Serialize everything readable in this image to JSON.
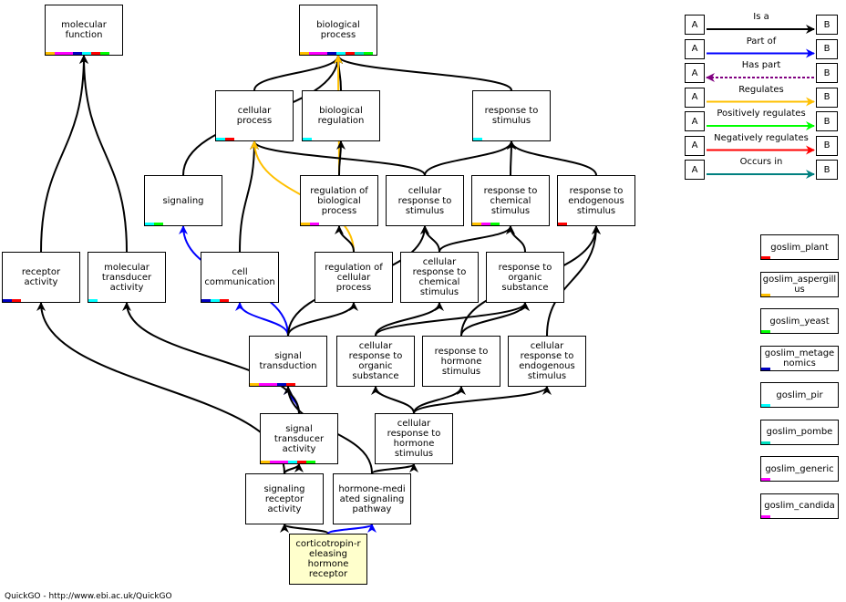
{
  "colors": {
    "is_a": "#000000",
    "part_of": "#0000ff",
    "has_part": "#800080",
    "regulates": "#ffc000",
    "positively_regulates": "#00ff00",
    "negatively_regulates": "#ff0000",
    "occurs_in": "#008080",
    "query_fill": "#ffffcc",
    "slim_orange": "#ffc000",
    "slim_magenta": "#ff00ff",
    "slim_blue": "#0000c0",
    "slim_cyan": "#00ffff",
    "slim_red": "#ff0000",
    "slim_teal": "#00e0c0",
    "slim_green": "#00ff00",
    "slim_darkred": "#e00000"
  },
  "nodes": [
    {
      "id": "mf",
      "label": "molecular\nfunction",
      "slims": [
        "orange",
        "magenta",
        "magenta",
        "blue",
        "cyan",
        "red",
        "green"
      ]
    },
    {
      "id": "bp",
      "label": "biological\nprocess",
      "slims": [
        "orange",
        "magenta",
        "magenta",
        "blue",
        "cyan",
        "red",
        "teal",
        "green"
      ]
    },
    {
      "id": "cp",
      "label": "cellular\nprocess",
      "slims": [
        "cyan",
        "red"
      ]
    },
    {
      "id": "br",
      "label": "biological\nregulation",
      "slims": [
        "cyan"
      ]
    },
    {
      "id": "rts",
      "label": "response to\nstimulus",
      "slims": [
        "cyan"
      ]
    },
    {
      "id": "sig",
      "label": "signaling",
      "slims": [
        "cyan",
        "green"
      ]
    },
    {
      "id": "rbp",
      "label": "regulation of\nbiological\nprocess",
      "slims": [
        "orange",
        "magenta"
      ]
    },
    {
      "id": "crs",
      "label": "cellular\nresponse to\nstimulus",
      "slims": []
    },
    {
      "id": "rcs",
      "label": "response to\nchemical\nstimulus",
      "slims": [
        "orange",
        "magenta",
        "green"
      ]
    },
    {
      "id": "res",
      "label": "response to\nendogenous\nstimulus",
      "slims": [
        "red"
      ]
    },
    {
      "id": "ra",
      "label": "receptor\nactivity",
      "slims": [
        "blue",
        "red"
      ]
    },
    {
      "id": "mta",
      "label": "molecular\ntransducer\nactivity",
      "slims": [
        "cyan"
      ]
    },
    {
      "id": "cc",
      "label": "cell\ncommunication",
      "slims": [
        "blue",
        "cyan",
        "red"
      ]
    },
    {
      "id": "rcp",
      "label": "regulation of\ncellular\nprocess",
      "slims": []
    },
    {
      "id": "crcs",
      "label": "cellular\nresponse to\nchemical\nstimulus",
      "slims": []
    },
    {
      "id": "ros",
      "label": "response to\norganic\nsubstance",
      "slims": []
    },
    {
      "id": "st",
      "label": "signal\ntransduction",
      "slims": [
        "orange",
        "magenta",
        "magenta",
        "blue",
        "red"
      ]
    },
    {
      "id": "cros",
      "label": "cellular\nresponse to\norganic\nsubstance",
      "slims": []
    },
    {
      "id": "rhs",
      "label": "response to\nhormone\nstimulus",
      "slims": []
    },
    {
      "id": "cres",
      "label": "cellular\nresponse to\nendogenous\nstimulus",
      "slims": []
    },
    {
      "id": "sta",
      "label": "signal\ntransducer\nactivity",
      "slims": [
        "orange",
        "magenta",
        "magenta",
        "cyan",
        "red",
        "green"
      ]
    },
    {
      "id": "crhs",
      "label": "cellular\nresponse to\nhormone\nstimulus",
      "slims": []
    },
    {
      "id": "sra",
      "label": "signaling\nreceptor\nactivity",
      "slims": []
    },
    {
      "id": "hmsp",
      "label": "hormone-medi\nated signaling\npathway",
      "slims": []
    },
    {
      "id": "crhr",
      "label": "corticotropin-r\neleasing\nhormone\nreceptor",
      "slims": [],
      "query": true
    }
  ],
  "edges": [
    {
      "from": "ra",
      "to": "mf",
      "type": "is_a"
    },
    {
      "from": "mta",
      "to": "mf",
      "type": "is_a"
    },
    {
      "from": "cp",
      "to": "bp",
      "type": "is_a"
    },
    {
      "from": "br",
      "to": "bp",
      "type": "is_a"
    },
    {
      "from": "rts",
      "to": "bp",
      "type": "is_a"
    },
    {
      "from": "sig",
      "to": "bp",
      "type": "is_a"
    },
    {
      "from": "rbp",
      "to": "bp",
      "type": "regulates"
    },
    {
      "from": "rbp",
      "to": "br",
      "type": "is_a"
    },
    {
      "from": "crs",
      "to": "cp",
      "type": "is_a"
    },
    {
      "from": "crs",
      "to": "rts",
      "type": "is_a"
    },
    {
      "from": "rcs",
      "to": "rts",
      "type": "is_a"
    },
    {
      "from": "res",
      "to": "rts",
      "type": "is_a"
    },
    {
      "from": "cc",
      "to": "cp",
      "type": "is_a"
    },
    {
      "from": "rcp",
      "to": "cp",
      "type": "regulates"
    },
    {
      "from": "rcp",
      "to": "rbp",
      "type": "is_a"
    },
    {
      "from": "crcs",
      "to": "crs",
      "type": "is_a"
    },
    {
      "from": "crcs",
      "to": "rcs",
      "type": "is_a"
    },
    {
      "from": "ros",
      "to": "rcs",
      "type": "is_a"
    },
    {
      "from": "st",
      "to": "sig",
      "type": "part_of"
    },
    {
      "from": "st",
      "to": "cc",
      "type": "part_of"
    },
    {
      "from": "st",
      "to": "rcp",
      "type": "is_a"
    },
    {
      "from": "st",
      "to": "crs",
      "type": "is_a"
    },
    {
      "from": "cros",
      "to": "crcs",
      "type": "is_a"
    },
    {
      "from": "cros",
      "to": "ros",
      "type": "is_a"
    },
    {
      "from": "rhs",
      "to": "ros",
      "type": "is_a"
    },
    {
      "from": "rhs",
      "to": "res",
      "type": "is_a"
    },
    {
      "from": "cres",
      "to": "res",
      "type": "is_a"
    },
    {
      "from": "sta",
      "to": "st",
      "type": "part_of"
    },
    {
      "from": "sta",
      "to": "mta",
      "type": "is_a"
    },
    {
      "from": "crhs",
      "to": "cros",
      "type": "is_a"
    },
    {
      "from": "crhs",
      "to": "rhs",
      "type": "is_a"
    },
    {
      "from": "crhs",
      "to": "cres",
      "type": "is_a"
    },
    {
      "from": "sra",
      "to": "sta",
      "type": "is_a"
    },
    {
      "from": "sra",
      "to": "ra",
      "type": "is_a"
    },
    {
      "from": "hmsp",
      "to": "crhs",
      "type": "is_a"
    },
    {
      "from": "hmsp",
      "to": "st",
      "type": "is_a"
    },
    {
      "from": "crhr",
      "to": "sra",
      "type": "is_a"
    },
    {
      "from": "crhr",
      "to": "hmsp",
      "type": "part_of"
    }
  ],
  "legend": {
    "box_a": "A",
    "box_b": "B",
    "items": [
      {
        "label": "Is a",
        "type": "is_a"
      },
      {
        "label": "Part of",
        "type": "part_of"
      },
      {
        "label": "Has part",
        "type": "has_part"
      },
      {
        "label": "Regulates",
        "type": "regulates"
      },
      {
        "label": "Positively regulates",
        "type": "positively_regulates"
      },
      {
        "label": "Negatively regulates",
        "type": "negatively_regulates"
      },
      {
        "label": "Occurs in",
        "type": "occurs_in"
      }
    ]
  },
  "slim_legend": [
    {
      "label": "goslim_plant",
      "color": "red"
    },
    {
      "label": "goslim_aspergillus",
      "color": "orange"
    },
    {
      "label": "goslim_yeast",
      "color": "green"
    },
    {
      "label": "goslim_metagenomics",
      "color": "blue"
    },
    {
      "label": "goslim_pir",
      "color": "cyan"
    },
    {
      "label": "goslim_pombe",
      "color": "teal"
    },
    {
      "label": "goslim_generic",
      "color": "magenta"
    },
    {
      "label": "goslim_candida",
      "color": "magenta"
    }
  ],
  "footer": "QuickGO - http://www.ebi.ac.uk/QuickGO"
}
